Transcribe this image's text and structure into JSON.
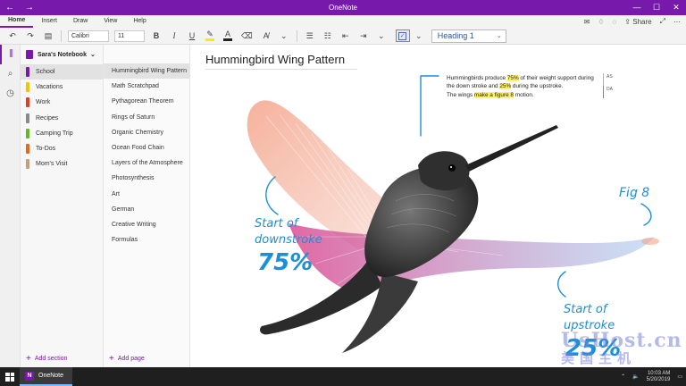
{
  "window": {
    "title": "OneNote"
  },
  "menu": {
    "tabs": [
      "Home",
      "Insert",
      "Draw",
      "View",
      "Help"
    ],
    "active_tab": "Home",
    "share_label": "Share"
  },
  "toolbar": {
    "font_name": "Calibri",
    "font_size": "11",
    "bold_label": "B",
    "italic_label": "I",
    "underline_label": "U",
    "font_color_label": "A",
    "style_label": "Heading 1"
  },
  "notebook": {
    "name": "Sara's Notebook",
    "sections": [
      {
        "label": "School",
        "color": "#7719aa"
      },
      {
        "label": "Vacations",
        "color": "#f5c400"
      },
      {
        "label": "Work",
        "color": "#e33d22"
      },
      {
        "label": "Recipes",
        "color": "#8a8a8a"
      },
      {
        "label": "Camping Trip",
        "color": "#67b42f"
      },
      {
        "label": "To-Dos",
        "color": "#e8691c"
      },
      {
        "label": "Mom's Visit",
        "color": "#c3a07a"
      }
    ],
    "add_section_label": "Add section"
  },
  "pages": {
    "items": [
      "Hummingbird Wing Pattern",
      "Math Scratchpad",
      "Pythagorean Theorem",
      "Rings of Saturn",
      "Organic Chemistry",
      "Ocean Food Chain",
      "Layers of the Atmosphere",
      "Photosynthesis",
      "Art",
      "German",
      "Creative Writing",
      "Formulas"
    ],
    "add_page_label": "Add page"
  },
  "page": {
    "title": "Hummingbird Wing Pattern",
    "note": {
      "line1_a": "Hummingbirds produce ",
      "line1_b": "75%",
      "line1_c": " of their weight support during the down stroke and ",
      "line1_d": "25%",
      "line1_e": " during the upstroke.",
      "line2_a": "The wings ",
      "line2_b": "make a figure 8",
      "line2_c": " motion."
    },
    "tags": [
      "AS",
      "DA"
    ],
    "ink": {
      "downstroke_l1": "Start of",
      "downstroke_l2": "downstroke",
      "downstroke_pct": "75%",
      "fig": "Fig 8",
      "upstroke_l1": "Start of",
      "upstroke_l2": "upstroke",
      "upstroke_pct": "25%"
    }
  },
  "taskbar": {
    "app_label": "OneNote",
    "time": "10:03 AM",
    "date": "5/20/2019"
  },
  "watermark": {
    "line1": "UsHost.cn",
    "line2": "美国主机"
  },
  "colors": {
    "accent": "#7719aa",
    "ink_blue": "#1b8fd8",
    "highlight": "#fff26a"
  }
}
